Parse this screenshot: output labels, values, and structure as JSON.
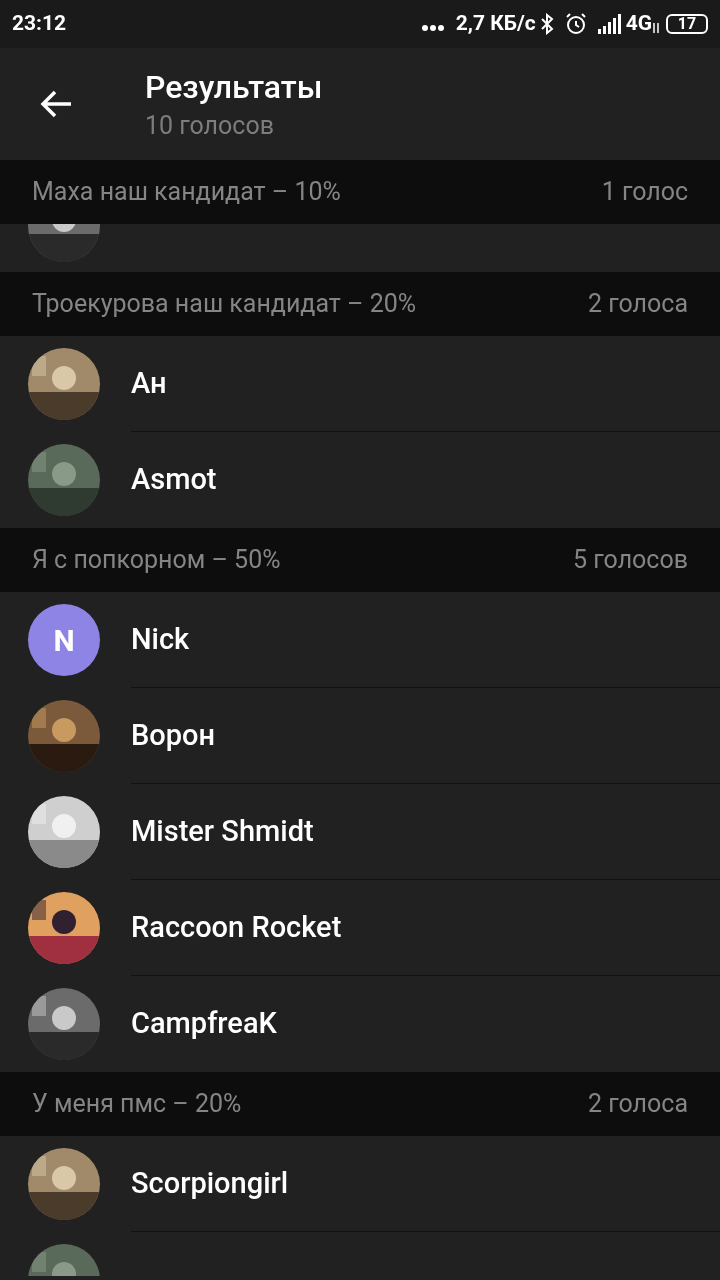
{
  "status_bar": {
    "time": "23:12",
    "speed": "2,7 КБ/с",
    "network": "4G",
    "battery": "17"
  },
  "header": {
    "title": "Результаты",
    "subtitle": "10 голосов"
  },
  "sections": [
    {
      "option": "Маха наш кандидат – 10%",
      "count": "1 голос",
      "voters": [
        {
          "kind": "picture",
          "clipped": true
        }
      ]
    },
    {
      "option": "Троекурова наш кандидат – 20%",
      "count": "2 голоса",
      "voters": [
        {
          "kind": "picture",
          "name": "Ан"
        },
        {
          "kind": "picture",
          "name": "Asmot"
        }
      ]
    },
    {
      "option": "Я с попкорном – 50%",
      "count": "5 голосов",
      "voters": [
        {
          "kind": "letter",
          "letter": "N",
          "color": "#8e84e6",
          "name": "Nick"
        },
        {
          "kind": "picture",
          "name": "Ворон"
        },
        {
          "kind": "picture",
          "name": "Mister Shmidt"
        },
        {
          "kind": "picture",
          "name": "Raccoon Rocket"
        },
        {
          "kind": "picture",
          "name": "CampfreaK"
        }
      ]
    },
    {
      "option": "У меня пмс – 20%",
      "count": "2 голоса",
      "voters": [
        {
          "kind": "picture",
          "name": "Scorpiongirl"
        },
        {
          "kind": "picture",
          "clipped": true
        }
      ]
    }
  ]
}
